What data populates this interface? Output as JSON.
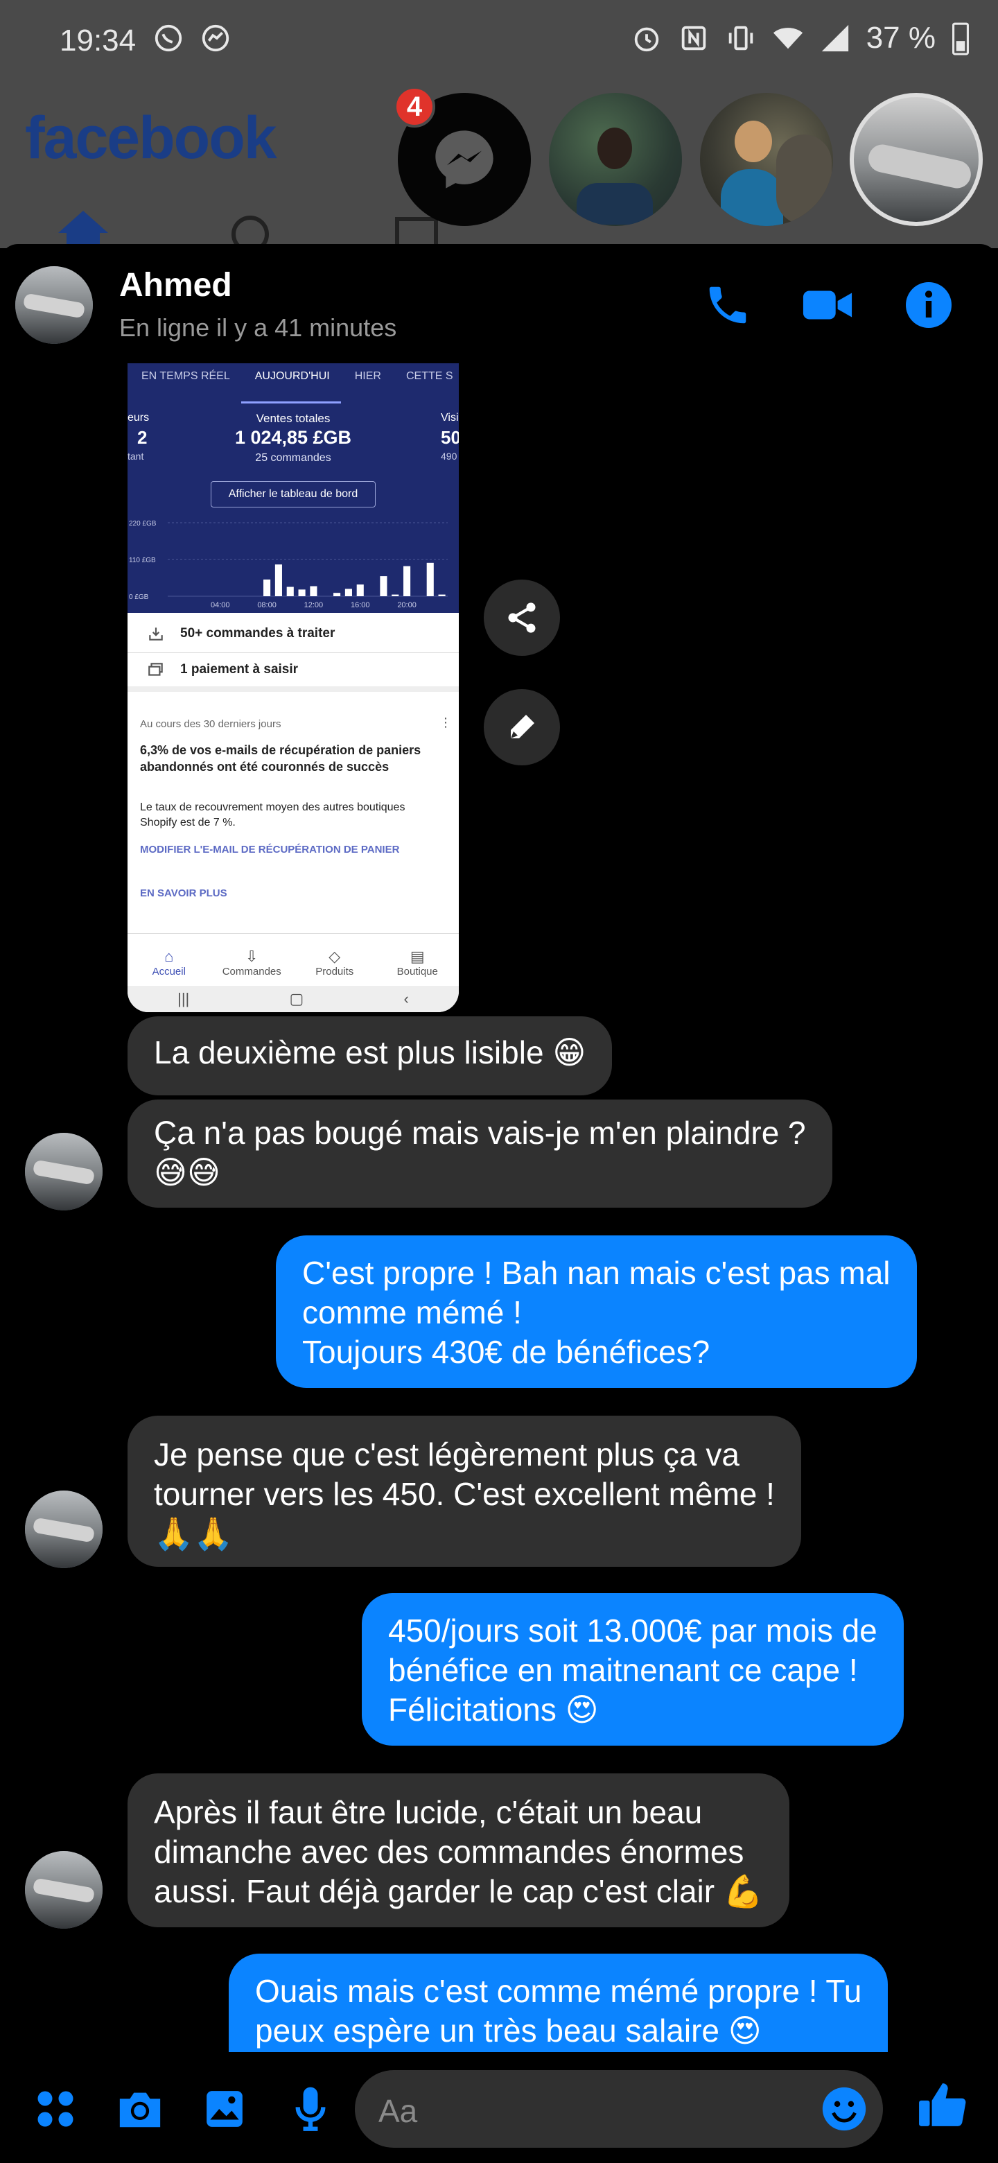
{
  "status_bar": {
    "time": "19:34",
    "battery": "37 %"
  },
  "background_app": {
    "logo": "facebook",
    "badge_count": "4"
  },
  "chat": {
    "name": "Ahmed",
    "status": "En ligne il y a 41 minutes"
  },
  "shared_image": {
    "tabs": [
      "EN TEMPS RÉEL",
      "AUJOURD'HUI",
      "HIER",
      "CETTE S"
    ],
    "left_partial_label": "eurs",
    "left_partial_value": "2",
    "left_partial_sub": "tant",
    "total_label": "Ventes totales",
    "total_value": "1 024,85 £GB",
    "orders": "25 commandes",
    "right_partial_label": "Visi",
    "right_partial_value": "50",
    "right_partial_sub": "490",
    "dashboard_button": "Afficher le tableau de bord",
    "chart_data": {
      "type": "bar",
      "categories": [
        "00:00",
        "01:00",
        "02:00",
        "03:00",
        "04:00",
        "05:00",
        "06:00",
        "07:00",
        "08:00",
        "09:00",
        "10:00",
        "11:00",
        "12:00",
        "13:00",
        "14:00",
        "15:00",
        "16:00",
        "17:00",
        "18:00",
        "19:00",
        "20:00",
        "21:00",
        "22:00",
        "23:00"
      ],
      "values": [
        0,
        0,
        0,
        0,
        0,
        0,
        0,
        0,
        50,
        95,
        28,
        20,
        30,
        0,
        10,
        22,
        35,
        0,
        60,
        5,
        90,
        0,
        100,
        5
      ],
      "ylim": [
        0,
        220
      ],
      "y_ticks": [
        "220 £GB",
        "110 £GB",
        "0 £GB"
      ],
      "x_ticks": [
        "04:00",
        "08:00",
        "12:00",
        "16:00",
        "20:00"
      ]
    },
    "task1": "50+ commandes à traiter",
    "task2": "1 paiement à saisir",
    "card_caption": "Au cours des 30 derniers jours",
    "card_title": "6,3% de vos e-mails de récupération de paniers abandonnés ont été couronnés de succès",
    "card_body": "Le taux de recouvrement moyen des autres boutiques Shopify est de 7 %.",
    "card_link1": "MODIFIER L'E-MAIL DE RÉCUPÉRATION DE PANIER",
    "card_link2": "EN SAVOIR PLUS",
    "nav": [
      "Accueil",
      "Commandes",
      "Produits",
      "Boutique"
    ]
  },
  "messages": [
    {
      "dir": "in",
      "lines": [
        "La deuxième est plus lisible 😁"
      ]
    },
    {
      "dir": "in",
      "lines": [
        "Ça n'a pas bougé mais vais-je m'en plaindre ?",
        "😅😅"
      ]
    },
    {
      "dir": "out",
      "lines": [
        "C'est propre ! Bah nan mais c'est pas mal",
        "comme mémé !",
        "Toujours 430€ de bénéfices?"
      ]
    },
    {
      "dir": "in",
      "lines": [
        "Je pense que c'est légèrement plus ça va",
        "tourner vers les 450. C'est excellent même !",
        "🙏🙏"
      ]
    },
    {
      "dir": "out",
      "lines": [
        "450/jours soit 13.000€ par mois de",
        "bénéfice en maitnenant ce cape !",
        "Félicitations 😍"
      ]
    },
    {
      "dir": "in",
      "lines": [
        "Après il faut être lucide, c'était un beau",
        "dimanche avec des commandes énormes",
        "aussi. Faut déjà garder le cap c'est clair 💪"
      ]
    },
    {
      "dir": "out",
      "lines": [
        "Ouais mais c'est comme mémé propre ! Tu",
        "peux espère un très beau salaire 😍"
      ]
    }
  ],
  "composer": {
    "placeholder": "Aa"
  },
  "colors": {
    "accent": "#0b84ff",
    "incoming": "#303030",
    "badge": "#e0332b"
  }
}
